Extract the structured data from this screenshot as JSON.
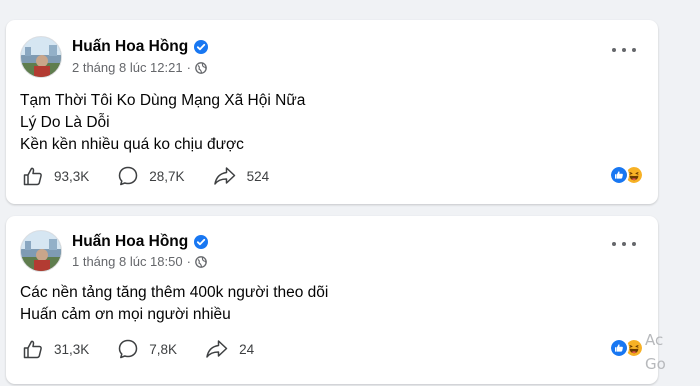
{
  "posts": [
    {
      "author": "Huấn Hoa Hồng",
      "timestamp": "2 tháng 8 lúc 12:21",
      "separator": "·",
      "privacy_icon": "globe-icon",
      "lines": [
        "Tạm Thời Tôi Ko Dùng Mạng Xã Hội Nữa",
        "Lý Do Là Dỗi",
        "Kền kền nhiều quá ko chịu được"
      ],
      "likes": "93,3K",
      "comments": "28,7K",
      "shares": "524",
      "reactions": [
        "like-reaction-icon",
        "haha-reaction-icon"
      ]
    },
    {
      "author": "Huấn Hoa Hồng",
      "timestamp": "1 tháng 8 lúc 18:50",
      "separator": "·",
      "privacy_icon": "globe-icon",
      "lines": [
        "Các nền tảng tăng thêm 400k người theo dõi",
        "Huấn cảm ơn mọi người nhiều"
      ],
      "likes": "31,3K",
      "comments": "7,8K",
      "shares": "24",
      "reactions": [
        "like-reaction-icon",
        "haha-reaction-icon"
      ]
    }
  ],
  "watermark": {
    "line1": "Ac",
    "line2": "Go"
  },
  "colors": {
    "background": "#f0f2f5",
    "card": "#ffffff",
    "verified": "#1877f2",
    "meta_text": "#65676b",
    "like": "#1877f2",
    "haha": "#f7b125"
  }
}
